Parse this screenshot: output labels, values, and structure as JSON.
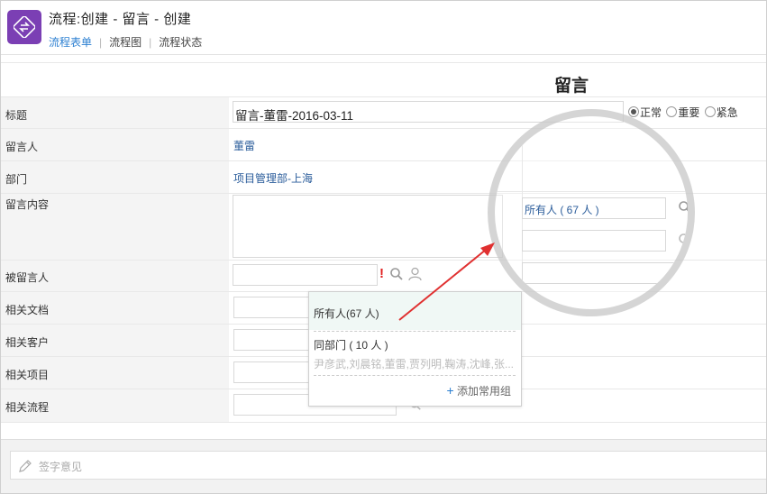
{
  "header": {
    "title": "流程:创建 - 留言 - 创建",
    "tabs": [
      {
        "label": "流程表单",
        "active": true
      },
      {
        "label": "流程图",
        "active": false
      },
      {
        "label": "流程状态",
        "active": false
      }
    ],
    "tab_separator": "|"
  },
  "form": {
    "title": "留言",
    "fields": {
      "subject": {
        "label": "标题",
        "value": "留言-董雷-2016-03-11"
      },
      "priority": {
        "options": [
          "正常",
          "重要",
          "紧急"
        ],
        "selected": "正常"
      },
      "author": {
        "label": "留言人",
        "value": "董雷"
      },
      "department": {
        "label": "部门",
        "value": "项目管理部-上海"
      },
      "content": {
        "label": "留言内容"
      },
      "recipient": {
        "label": "被留言人",
        "required_mark": "!"
      },
      "documents": {
        "label": "相关文档"
      },
      "customers": {
        "label": "相关客户"
      },
      "projects": {
        "label": "相关项目"
      },
      "workflows": {
        "label": "相关流程"
      }
    }
  },
  "popup": {
    "items": [
      {
        "label": "所有人(67 人)"
      },
      {
        "label": "同部门 ( 10 人 )",
        "members": "尹彦武,刘晨铭,董雷,贾列明,鞠涛,沈峰,张..."
      }
    ],
    "add_icon": "+",
    "add_label": "添加常用组"
  },
  "magnifier": {
    "value": "所有人 ( 67 人 )"
  },
  "footer": {
    "sign_placeholder": "签字意见"
  },
  "colors": {
    "accent": "#2b7fd1",
    "app_icon": "#7b3fb4",
    "arrow": "#e03030",
    "required": "#e02020"
  },
  "icons": [
    "workflow-app-icon",
    "search-icon",
    "user-icon",
    "plus-icon",
    "pencil-icon",
    "arrow-annotation"
  ]
}
